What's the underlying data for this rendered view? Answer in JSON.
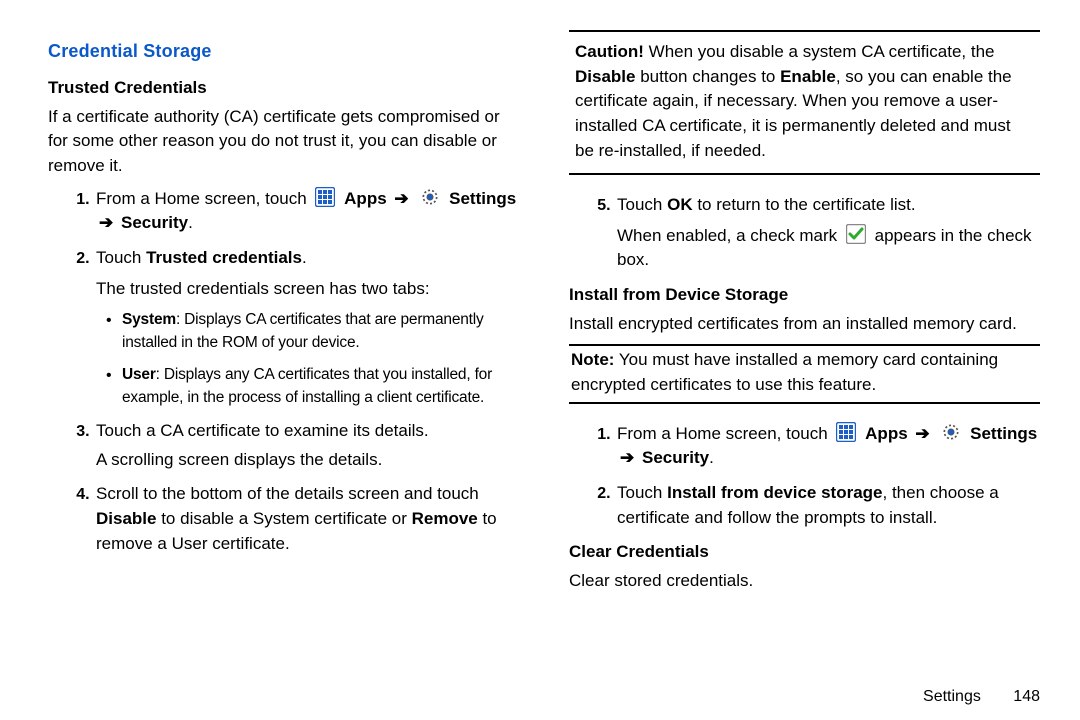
{
  "left": {
    "section_title": "Credential Storage",
    "trusted_heading": "Trusted Credentials",
    "intro": "If a certificate authority (CA) certificate gets compromised or for some other reason you do not trust it, you can disable or remove it.",
    "step1_prefix": "From a Home screen, touch ",
    "apps_label": "Apps",
    "arrow": "➔",
    "settings_label": "Settings",
    "security_label": "Security",
    "step1_suffix": ".",
    "step2_prefix": "Touch ",
    "step2_bold": "Trusted credentials",
    "step2_suffix": ".",
    "tabs_line": "The trusted credentials screen has two tabs:",
    "bullet_system_bold": "System",
    "bullet_system_rest": ": Displays CA certificates that are permanently installed in the ROM of your device.",
    "bullet_user_bold": "User",
    "bullet_user_rest": ": Displays any CA certificates that you installed, for example, in the process of installing a client certificate.",
    "step3_line1": "Touch a CA certificate to examine its details.",
    "step3_line2": "A scrolling screen displays the details.",
    "step4_a": "Scroll to the bottom of the details screen and touch ",
    "step4_b1": "Disable",
    "step4_c": " to disable a System certificate or ",
    "step4_b2": "Remove",
    "step4_d": " to remove a User certificate."
  },
  "right": {
    "caution_label": "Caution!",
    "caution_a": " When you disable a system CA certificate, the ",
    "caution_b1": "Disable",
    "caution_c": " button changes to ",
    "caution_b2": "Enable",
    "caution_d": ", so you can enable the certificate again, if necessary. When you remove a user-installed CA certificate, it is permanently deleted and must be re-installed, if needed.",
    "step5_a": "Touch ",
    "step5_b": "OK",
    "step5_c": " to return to the certificate list.",
    "step5_line2a": "When enabled, a check mark ",
    "step5_line2b": " appears in the check box.",
    "install_heading": "Install from Device Storage",
    "install_intro": "Install encrypted certificates from an installed memory card.",
    "note_label": "Note:",
    "note_rest": " You must have installed a memory card containing encrypted certificates to use this feature.",
    "rstep1_prefix": "From a Home screen, touch ",
    "rstep2_a": "Touch ",
    "rstep2_b": "Install from device storage",
    "rstep2_c": ", then choose a certificate and follow the prompts to install.",
    "clear_heading": "Clear Credentials",
    "clear_body": "Clear stored credentials."
  },
  "footer": {
    "section": "Settings",
    "page": "148"
  }
}
